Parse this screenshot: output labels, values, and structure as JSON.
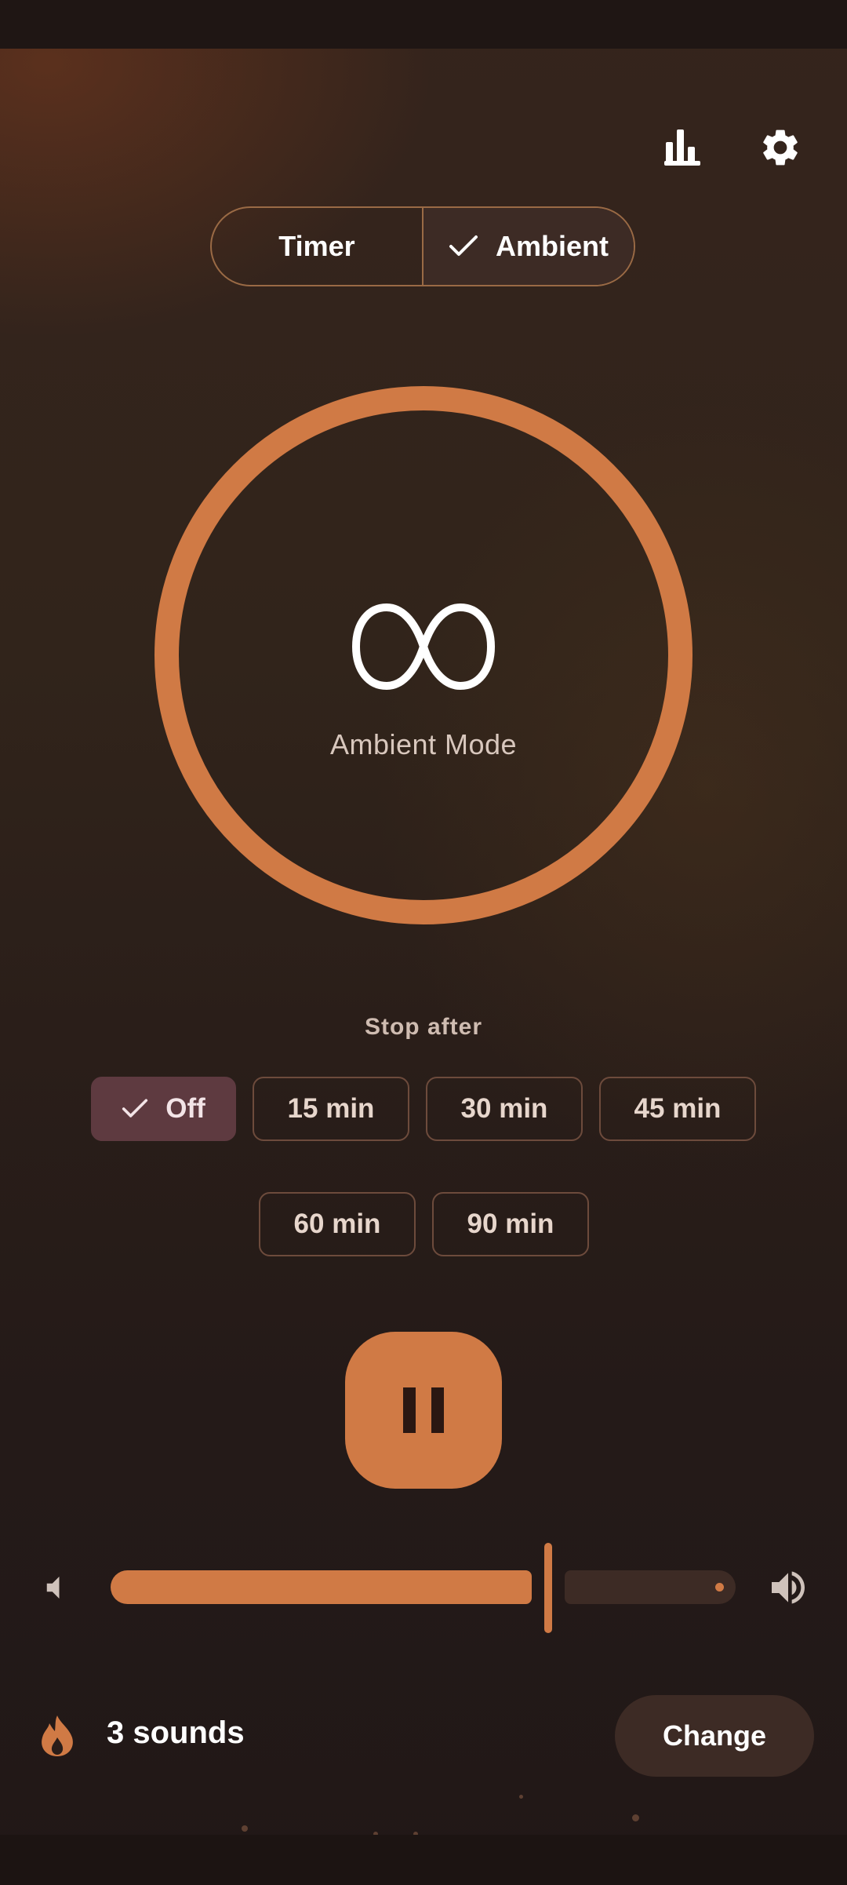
{
  "header": {
    "stats_icon": "bar-chart-icon",
    "settings_icon": "gear-icon"
  },
  "mode_toggle": {
    "timer_label": "Timer",
    "ambient_label": "Ambient",
    "selected": "Ambient"
  },
  "dial": {
    "symbol": "∞",
    "label": "Ambient Mode"
  },
  "stop_after": {
    "label": "Stop after",
    "options": [
      "Off",
      "15 min",
      "30 min",
      "45 min",
      "60 min",
      "90 min"
    ],
    "selected": "Off"
  },
  "playback": {
    "state": "playing",
    "button_icon": "pause-icon"
  },
  "volume": {
    "level_percent": 70,
    "low_icon": "volume-low-icon",
    "high_icon": "volume-high-icon"
  },
  "sounds": {
    "icon": "flame-icon",
    "count_label": "3 sounds",
    "change_label": "Change"
  },
  "colors": {
    "accent": "#d07a45",
    "selected_chip": "#5e3a40",
    "surface": "#3d2b25"
  }
}
